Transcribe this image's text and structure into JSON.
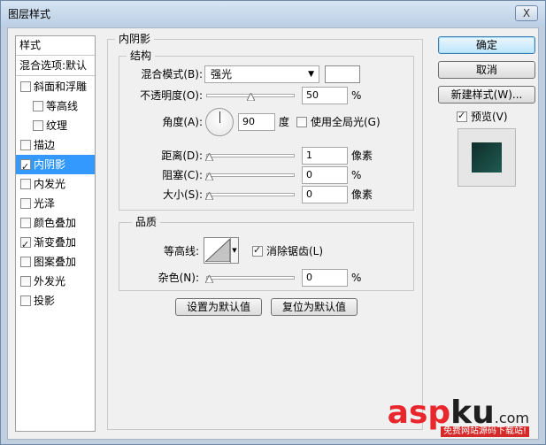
{
  "window": {
    "title": "图层样式",
    "close_label": "X"
  },
  "sidebar": {
    "header": "样式",
    "blend_options": "混合选项:默认",
    "items": [
      {
        "label": "斜面和浮雕",
        "checked": false,
        "sub": false,
        "selected": false
      },
      {
        "label": "等高线",
        "checked": false,
        "sub": true,
        "selected": false
      },
      {
        "label": "纹理",
        "checked": false,
        "sub": true,
        "selected": false
      },
      {
        "label": "描边",
        "checked": false,
        "sub": false,
        "selected": false
      },
      {
        "label": "内阴影",
        "checked": true,
        "sub": false,
        "selected": true
      },
      {
        "label": "内发光",
        "checked": false,
        "sub": false,
        "selected": false
      },
      {
        "label": "光泽",
        "checked": false,
        "sub": false,
        "selected": false
      },
      {
        "label": "颜色叠加",
        "checked": false,
        "sub": false,
        "selected": false
      },
      {
        "label": "渐变叠加",
        "checked": true,
        "sub": false,
        "selected": false
      },
      {
        "label": "图案叠加",
        "checked": false,
        "sub": false,
        "selected": false
      },
      {
        "label": "外发光",
        "checked": false,
        "sub": false,
        "selected": false
      },
      {
        "label": "投影",
        "checked": false,
        "sub": false,
        "selected": false
      }
    ]
  },
  "main": {
    "title": "内阴影",
    "structure": {
      "title": "结构",
      "blend_mode_label": "混合模式(B):",
      "blend_mode_value": "强光",
      "opacity_label": "不透明度(O):",
      "opacity_value": "50",
      "opacity_unit": "%",
      "opacity_level": 0.5,
      "angle_label": "角度(A):",
      "angle_value": "90",
      "angle_unit": "度",
      "global_light_label": "使用全局光(G)",
      "global_light_checked": false,
      "distance_label": "距离(D):",
      "distance_value": "1",
      "distance_unit": "像素",
      "choke_label": "阻塞(C):",
      "choke_value": "0",
      "choke_unit": "%",
      "size_label": "大小(S):",
      "size_value": "0",
      "size_unit": "像素"
    },
    "quality": {
      "title": "品质",
      "contour_label": "等高线:",
      "anti_alias_label": "消除锯齿(L)",
      "anti_alias_checked": true,
      "noise_label": "杂色(N):",
      "noise_value": "0",
      "noise_unit": "%"
    },
    "make_default_label": "设置为默认值",
    "reset_default_label": "复位为默认值"
  },
  "buttons": {
    "ok": "确定",
    "cancel": "取消",
    "new_style": "新建样式(W)...",
    "preview_label": "预览(V)",
    "preview_checked": true
  },
  "watermark": {
    "asp": "asp",
    "ku": "ku",
    "com": ".com",
    "sub": "免费网站源码下载站!"
  },
  "colors": {
    "selection": "#3399ff",
    "preview_swatch": "#143f39"
  }
}
